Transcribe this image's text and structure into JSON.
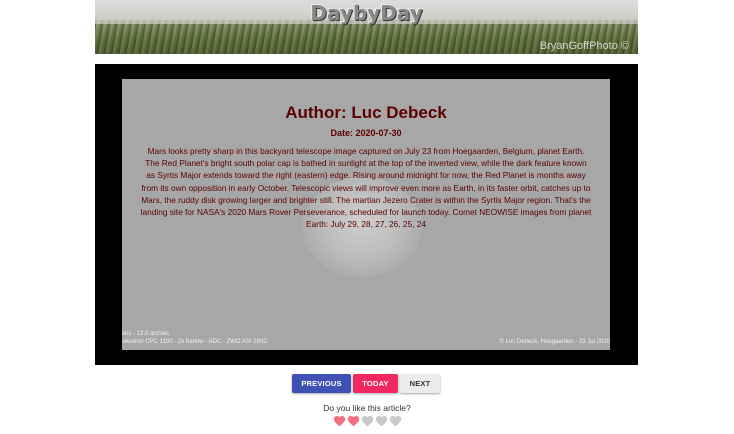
{
  "banner": {
    "title": "DaybyDay",
    "credit": "BryanGoffPhoto ©"
  },
  "article": {
    "author": "Author: Luc Debeck",
    "date": "Date: 2020-07-30",
    "body": "Mars looks pretty sharp in this backyard telescope image captured on July 23 from Hoegaarden, Belgium, planet Earth. The Red Planet's bright south polar cap is bathed in sunlight at the top of the inverted view, while the dark feature known as Syrtis Major extends toward the right (eastern) edge. Rising around midnight for now, the Red Planet is months away from its own opposition in early October. Telescopic views will improve even more as Earth, in its faster orbit, catches up to Mars, the ruddy disk growing larger and brighter still. The martian Jezero Crater is within the Syrtis Major region. That's the landing site for NASA's 2020 Mars Rover Perseverance, scheduled for launch today. Comet NEOWISE images from planet Earth: July 29, 28, 27, 26, 25, 24"
  },
  "image_caption": {
    "left_line1": "Mars - 13,6 arc/sec",
    "left_line2": "Celestron CPC 1100 - 2x barlow - ADC - ZWO ASI 290C",
    "right": "© Luc Debeck, Hoegaarden - 23 Jul 2020"
  },
  "nav": {
    "previous": "PREVIOUS",
    "today": "TODAY",
    "next": "NEXT"
  },
  "rating": {
    "question": "Do you like this article?",
    "value": 2,
    "max": 5,
    "filled_color": "#f2717d",
    "empty_color": "#c8c8c8",
    "icon": "heart-icon"
  },
  "colors": {
    "article_text": "#5c0000",
    "previous_button": "#3f51b5",
    "today_button": "#f0285e",
    "next_button": "#ececec"
  }
}
